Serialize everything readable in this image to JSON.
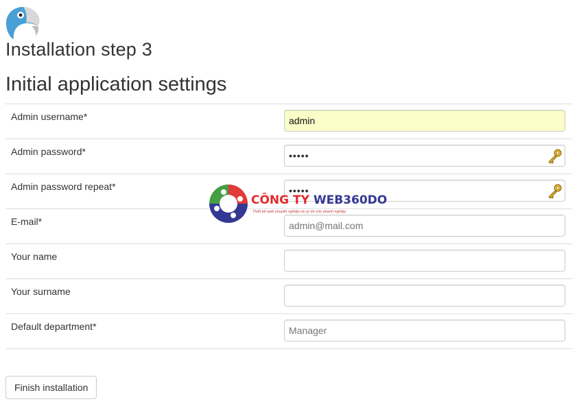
{
  "header": {
    "step_title": "Installation step 3",
    "section_title": "Initial application settings"
  },
  "form": {
    "fields": [
      {
        "label": "Admin username*",
        "value": "admin",
        "placeholder": ""
      },
      {
        "label": "Admin password*",
        "value": "•••••",
        "placeholder": ""
      },
      {
        "label": "Admin password repeat*",
        "value": "•••••",
        "placeholder": ""
      },
      {
        "label": "E-mail*",
        "value": "",
        "placeholder": "admin@mail.com"
      },
      {
        "label": "Your name",
        "value": "",
        "placeholder": ""
      },
      {
        "label": "Your surname",
        "value": "",
        "placeholder": ""
      },
      {
        "label": "Default department*",
        "value": "",
        "placeholder": "Manager"
      }
    ]
  },
  "actions": {
    "finish_label": "Finish installation"
  },
  "watermark": {
    "title_red": "CÔNG TY ",
    "title_blue": "WEB360DO",
    "subtitle": "Thiết kế web chuyên nghiệp và uy tín cho doanh nghiệp"
  },
  "colors": {
    "autofill_bg": "#fafdc7",
    "border": "#cccccc",
    "divider": "#dddddd",
    "text": "#333333"
  },
  "icons": {
    "logo": "parrot-logo-icon",
    "password_key": "key-icon"
  }
}
